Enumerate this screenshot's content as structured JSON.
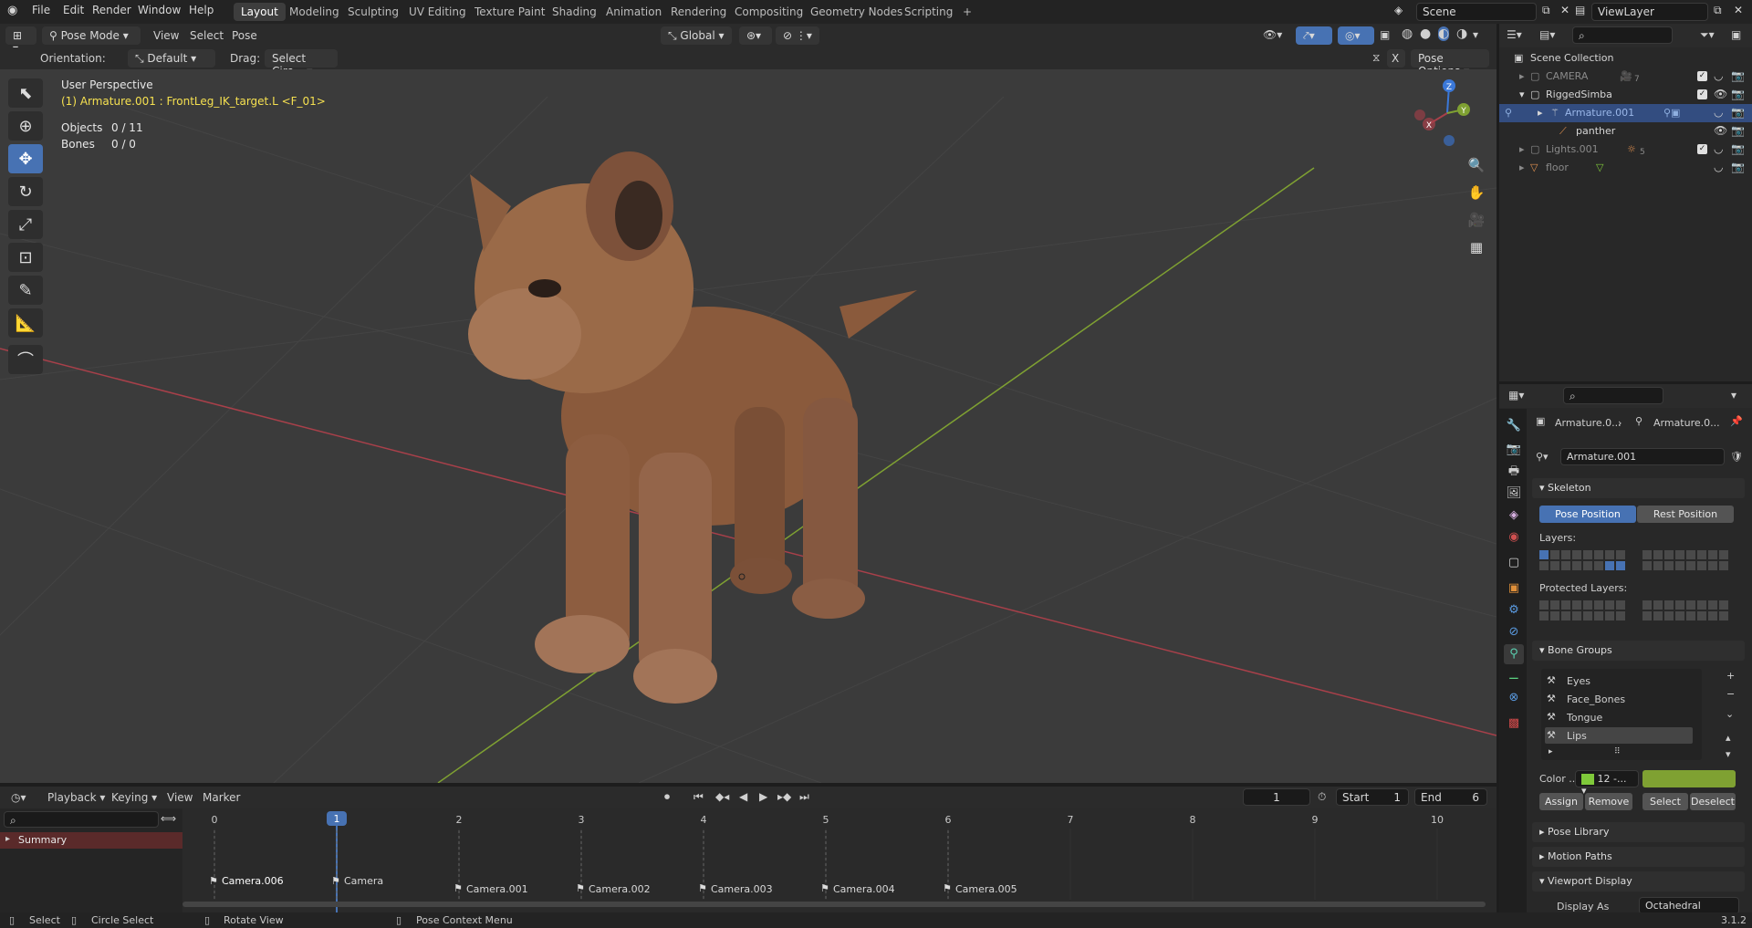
{
  "topbar": {
    "menus": [
      "File",
      "Edit",
      "Render",
      "Window",
      "Help"
    ],
    "workspaces": [
      "Layout",
      "Modeling",
      "Sculpting",
      "UV Editing",
      "Texture Paint",
      "Shading",
      "Animation",
      "Rendering",
      "Compositing",
      "Geometry Nodes",
      "Scripting"
    ],
    "active_workspace": "Layout",
    "add_tab": "+",
    "scene": "Scene",
    "view_layer": "ViewLayer"
  },
  "vp_header": {
    "mode": "Pose Mode",
    "menus": [
      "View",
      "Select",
      "Pose"
    ],
    "transform_orientation": "Global",
    "orientation_label": "Orientation:",
    "orientation_value": "Default",
    "drag_label": "Drag:",
    "drag_value": "Select Circ...",
    "pose_options": "Pose Options",
    "x_mirror": "X"
  },
  "viewport": {
    "view_name": "User Perspective",
    "active_info": "(1) Armature.001 : FrontLeg_IK_target.L <F_01>",
    "stats": [
      {
        "label": "Objects",
        "value": "0 / 11"
      },
      {
        "label": "Bones",
        "value": "0 / 0"
      }
    ],
    "gizmo_axes": [
      "Z",
      "X",
      "Y"
    ]
  },
  "outliner": {
    "root": "Scene Collection",
    "rows": [
      {
        "label": "CAMERA",
        "count": "7"
      },
      {
        "label": "RiggedSimba"
      },
      {
        "label": "Armature.001"
      },
      {
        "label": "panther"
      },
      {
        "label": "Lights.001",
        "count": "5"
      },
      {
        "label": "floor"
      }
    ]
  },
  "properties": {
    "breadcrumb_a": "Armature.0...",
    "breadcrumb_b": "Armature.0...",
    "data_name": "Armature.001",
    "skeleton": {
      "title": "Skeleton",
      "pose_position": "Pose Position",
      "rest_position": "Rest Position",
      "layers": "Layers:",
      "protected_layers": "Protected Layers:"
    },
    "bone_groups": {
      "title": "Bone Groups",
      "items": [
        "Eyes",
        "Face_Bones",
        "Tongue",
        "Lips"
      ],
      "color_label": "Color ...",
      "color_set": "12 -...",
      "assign": "Assign",
      "remove": "Remove",
      "select": "Select",
      "deselect": "Deselect"
    },
    "pose_library": "Pose Library",
    "motion_paths": "Motion Paths",
    "viewport_display": "Viewport Display",
    "display_as_label": "Display As",
    "display_as_value": "Octahedral"
  },
  "timeline": {
    "menus": [
      "Playback",
      "Keying",
      "View",
      "Marker"
    ],
    "current_frame": "1",
    "start_label": "Start",
    "start": "1",
    "end_label": "End",
    "end": "6",
    "summary": "Summary",
    "ticks": [
      "0",
      "1",
      "2",
      "3",
      "4",
      "5",
      "6",
      "7",
      "8",
      "9",
      "10"
    ],
    "playhead": "1",
    "markers": [
      {
        "label": "Camera.006",
        "frame": 0
      },
      {
        "label": "Camera",
        "frame": 1
      },
      {
        "label": "Camera.001",
        "frame": 2
      },
      {
        "label": "Camera.002",
        "frame": 3
      },
      {
        "label": "Camera.003",
        "frame": 4
      },
      {
        "label": "Camera.004",
        "frame": 5
      },
      {
        "label": "Camera.005",
        "frame": 6
      }
    ]
  },
  "statusbar": {
    "select": "Select",
    "circle_select": "Circle Select",
    "rotate_view": "Rotate View",
    "context_menu": "Pose Context Menu",
    "version": "3.1.2"
  },
  "colors": {
    "accent": "#4772b3",
    "x_axis": "#a8404a",
    "y_axis": "#7fa132",
    "info_text": "#f5e050",
    "bone_group_color": "#7fc93a"
  }
}
